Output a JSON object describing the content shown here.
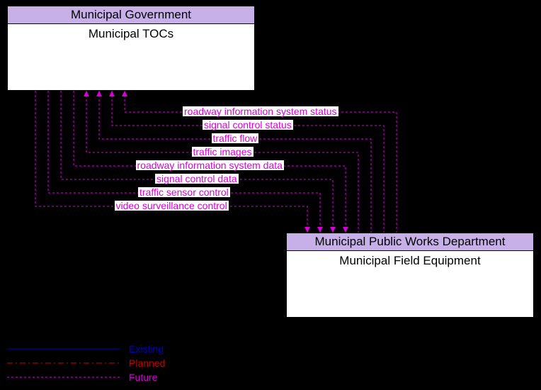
{
  "boxes": {
    "top": {
      "header": "Municipal Government",
      "title": "Municipal TOCs"
    },
    "bottom": {
      "header": "Municipal Public Works Department",
      "title": "Municipal Field Equipment"
    }
  },
  "flows": [
    {
      "label": "roadway information system status",
      "direction": "up"
    },
    {
      "label": "signal control status",
      "direction": "up"
    },
    {
      "label": "traffic flow",
      "direction": "up"
    },
    {
      "label": "traffic images",
      "direction": "up"
    },
    {
      "label": "roadway information system data",
      "direction": "down"
    },
    {
      "label": "signal control data",
      "direction": "down"
    },
    {
      "label": "traffic sensor control",
      "direction": "down"
    },
    {
      "label": "video surveillance control",
      "direction": "down"
    }
  ],
  "legend": {
    "items": [
      {
        "label": "Existing",
        "color": "#0000c8"
      },
      {
        "label": "Planned",
        "color": "#c80000"
      },
      {
        "label": "Future",
        "color": "#d900d9"
      }
    ]
  },
  "style": {
    "flow_line_color": "#d900d9"
  }
}
